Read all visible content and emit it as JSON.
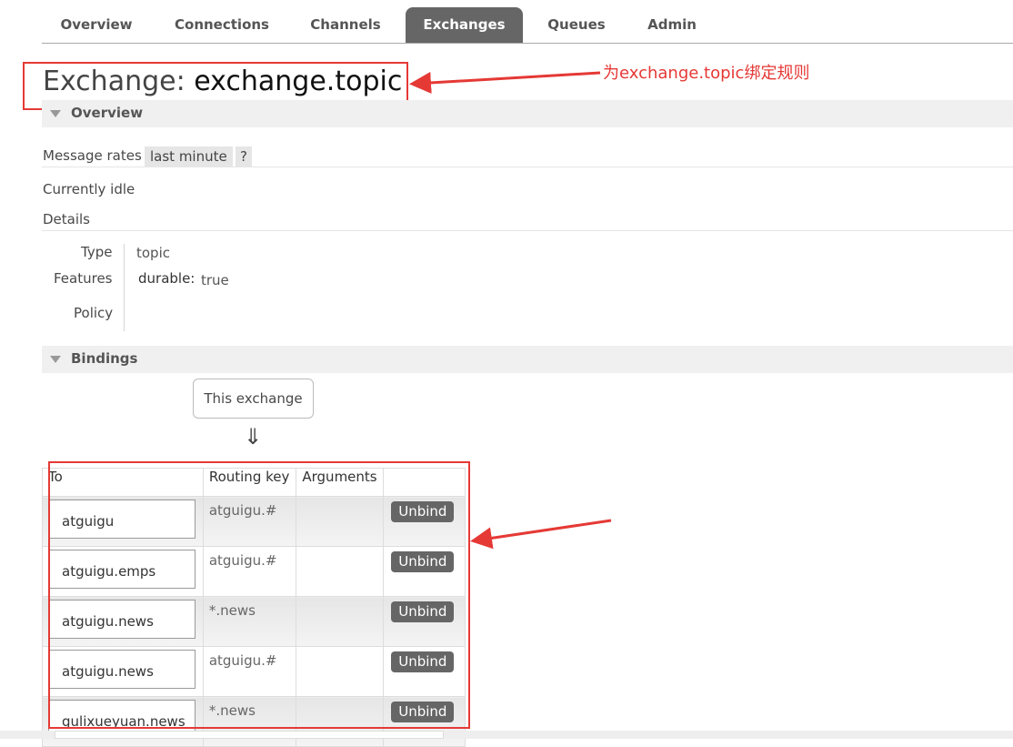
{
  "nav": {
    "tabs": [
      {
        "label": "Overview",
        "active": false
      },
      {
        "label": "Connections",
        "active": false
      },
      {
        "label": "Channels",
        "active": false
      },
      {
        "label": "Exchanges",
        "active": true
      },
      {
        "label": "Queues",
        "active": false
      },
      {
        "label": "Admin",
        "active": false
      }
    ]
  },
  "page": {
    "title_prefix": "Exchange:",
    "title_name": "exchange.topic"
  },
  "overview": {
    "header": "Overview",
    "message_rates_label": "Message rates",
    "message_rates_range": "last minute",
    "help": "?",
    "status": "Currently idle",
    "details_label": "Details",
    "details": {
      "type_label": "Type",
      "type_value": "topic",
      "features_label": "Features",
      "durable_label": "durable:",
      "durable_value": "true",
      "policy_label": "Policy"
    }
  },
  "bindings": {
    "header": "Bindings",
    "this_exchange": "This exchange",
    "arrow": "⇓",
    "columns": [
      "To",
      "Routing key",
      "Arguments",
      ""
    ],
    "rows": [
      {
        "to": "atguigu",
        "routing_key": "atguigu.#",
        "arguments": "",
        "action": "Unbind"
      },
      {
        "to": "atguigu.emps",
        "routing_key": "atguigu.#",
        "arguments": "",
        "action": "Unbind"
      },
      {
        "to": "atguigu.news",
        "routing_key": "*.news",
        "arguments": "",
        "action": "Unbind"
      },
      {
        "to": "atguigu.news",
        "routing_key": "atguigu.#",
        "arguments": "",
        "action": "Unbind"
      },
      {
        "to": "gulixueyuan.news",
        "routing_key": "*.news",
        "arguments": "",
        "action": "Unbind"
      }
    ]
  },
  "annotations": {
    "title_note": "为exchange.topic绑定规则",
    "color": "#e53935"
  },
  "colors": {
    "active_tab": "#666666",
    "button": "#666666",
    "annotation": "#e53935"
  }
}
